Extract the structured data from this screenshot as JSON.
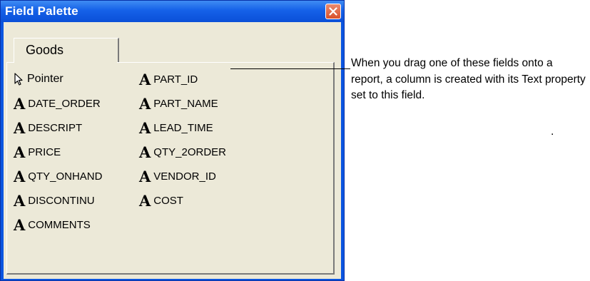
{
  "window": {
    "title": "Field Palette",
    "tab_label": "Goods"
  },
  "pointer": {
    "label": "Pointer",
    "icon": "arrow-pointer-icon"
  },
  "field_glyph": "A",
  "fields_left": [
    "DATE_ORDER",
    "DESCRIPT",
    "PRICE",
    "QTY_ONHAND",
    "DISCONTINU",
    "COMMENTS"
  ],
  "fields_right": [
    "PART_ID",
    "PART_NAME",
    "LEAD_TIME",
    "QTY_2ORDER",
    "VENDOR_ID",
    "COST"
  ],
  "callout": {
    "text": "When you drag one of these fields onto a report, a column is created with its Text property set to this field.",
    "dot": "."
  },
  "colors": {
    "titlebar": "#0a55e0",
    "client_bg": "#ece9d8",
    "close_button": "#d9512b"
  }
}
